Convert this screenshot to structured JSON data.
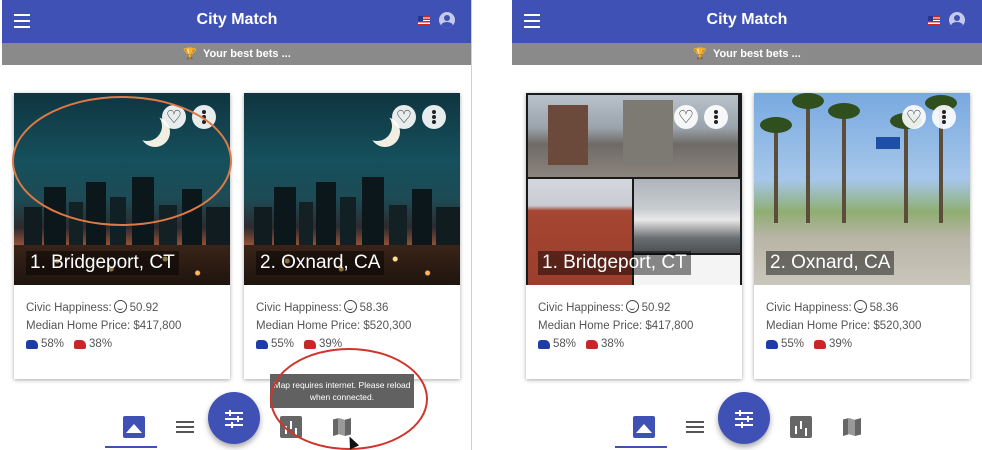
{
  "app": {
    "title": "City Match",
    "banner": "Your best bets ...",
    "trophy_icon": "trophy-icon"
  },
  "colors": {
    "primary": "#3f51b5",
    "subbar": "#8a8a8a",
    "democrat": "#1e3ca8",
    "republican": "#c62828",
    "annotation_orange": "#e07a44",
    "annotation_red": "#d1342a"
  },
  "labels": {
    "civic": "Civic Happiness:",
    "price": "Median Home Price:"
  },
  "left": {
    "cards": [
      {
        "name": "1. Bridgeport, CT",
        "civic": "50.92",
        "price": "$417,800",
        "dem": "58%",
        "rep": "38%"
      },
      {
        "name": "2. Oxnard, CA",
        "civic": "58.36",
        "price": "$520,300",
        "dem": "55%",
        "rep": "39%"
      }
    ],
    "tooltip": "Map requires internet. Please reload when connected."
  },
  "right": {
    "cards": [
      {
        "name": "1. Bridgeport, CT",
        "civic": "50.92",
        "price": "$417,800",
        "dem": "58%",
        "rep": "38%"
      },
      {
        "name": "2. Oxnard, CA",
        "civic": "58.36",
        "price": "$520,300",
        "dem": "55%",
        "rep": "39%"
      }
    ]
  },
  "nav": {
    "items": [
      "image-icon",
      "list-icon",
      "chart-icon",
      "map-icon"
    ],
    "active": "image-icon",
    "fab_icon": "tune-icon"
  }
}
